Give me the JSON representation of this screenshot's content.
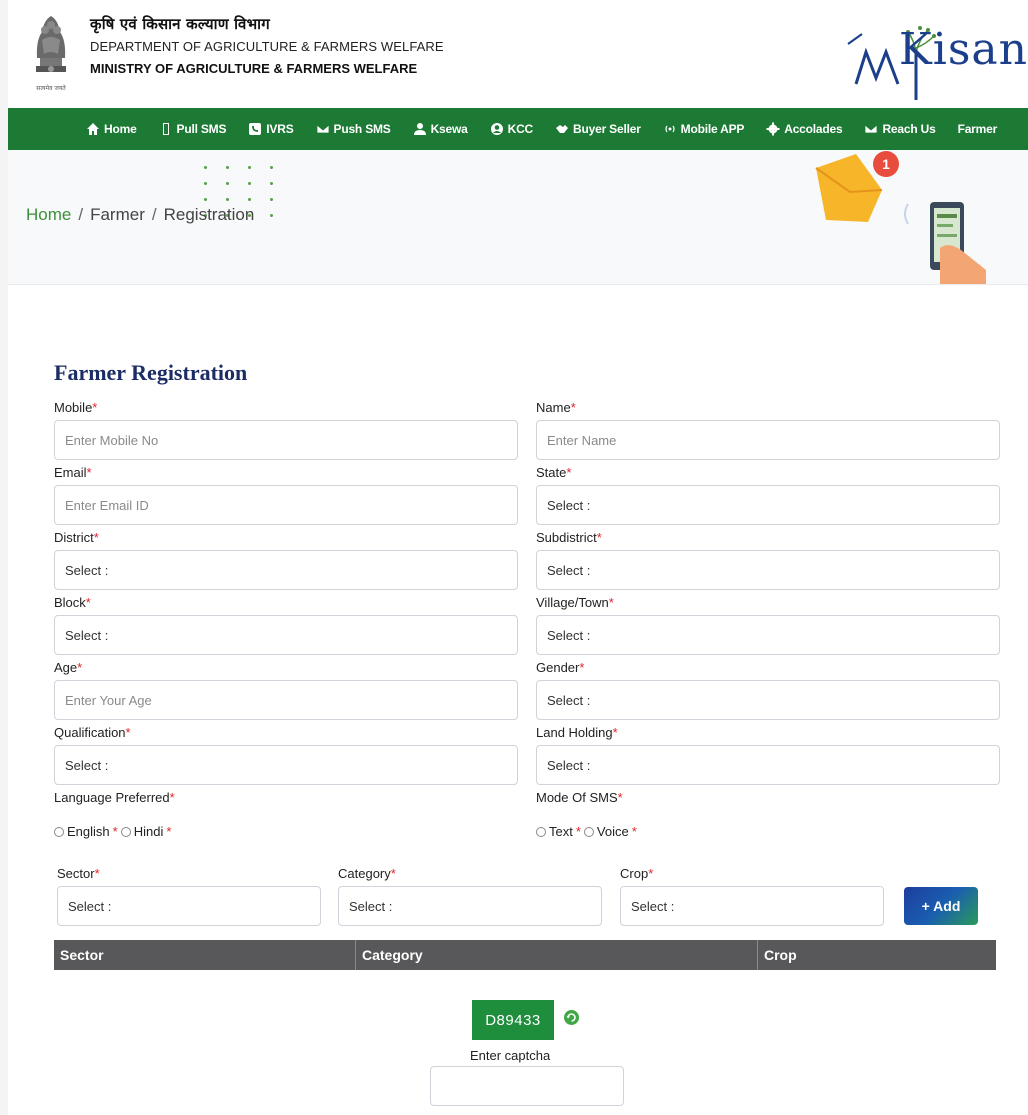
{
  "header": {
    "dept_hindi": "कृषि एवं किसान कल्याण विभाग",
    "dept_english": "DEPARTMENT OF AGRICULTURE & FARMERS WELFARE",
    "ministry": "MINISTRY OF AGRICULTURE & FARMERS WELFARE",
    "emblem_motto": "सत्यमेव जयते",
    "logo_text": "Kisan"
  },
  "nav": {
    "items": [
      {
        "label": "Home",
        "icon": "home-icon"
      },
      {
        "label": "Pull SMS",
        "icon": "phone-outline-icon"
      },
      {
        "label": "IVRS",
        "icon": "phone-icon"
      },
      {
        "label": "Push SMS",
        "icon": "envelope-icon"
      },
      {
        "label": "Ksewa",
        "icon": "user-icon"
      },
      {
        "label": "KCC",
        "icon": "account-circle-icon"
      },
      {
        "label": "Buyer Seller",
        "icon": "handshake-icon"
      },
      {
        "label": "Mobile APP",
        "icon": "signal-icon"
      },
      {
        "label": "Accolades",
        "icon": "cog-icon"
      },
      {
        "label": "Reach Us",
        "icon": "envelope-icon"
      },
      {
        "label": "Farmer",
        "icon": ""
      }
    ]
  },
  "breadcrumb": {
    "home": "Home",
    "section": "Farmer",
    "current": "Registration",
    "separator": "/"
  },
  "banner": {
    "notification_count": "1"
  },
  "form": {
    "title": "Farmer Registration",
    "required_mark": "*",
    "mobile": {
      "label": "Mobile",
      "placeholder": "Enter Mobile No"
    },
    "name": {
      "label": "Name",
      "placeholder": "Enter Name"
    },
    "email": {
      "label": "Email",
      "placeholder": "Enter Email ID"
    },
    "state": {
      "label": "State",
      "value": "Select :"
    },
    "district": {
      "label": "District",
      "value": "Select :"
    },
    "subdistrict": {
      "label": "Subdistrict",
      "value": "Select :"
    },
    "block": {
      "label": "Block",
      "value": "Select :"
    },
    "village": {
      "label": "Village/Town",
      "value": "Select :"
    },
    "age": {
      "label": "Age",
      "placeholder": "Enter Your Age"
    },
    "gender": {
      "label": "Gender",
      "value": "Select :"
    },
    "qualification": {
      "label": "Qualification",
      "value": "Select :"
    },
    "land_holding": {
      "label": "Land Holding",
      "value": "Select :"
    },
    "language": {
      "label": "Language Preferred",
      "option1": "English",
      "option2": "Hindi"
    },
    "sms_mode": {
      "label": "Mode Of SMS",
      "option1": "Text",
      "option2": "Voice"
    },
    "sector": {
      "label": "Sector",
      "value": "Select :"
    },
    "category": {
      "label": "Category",
      "value": "Select :"
    },
    "crop": {
      "label": "Crop",
      "value": "Select :"
    },
    "add_button": "+ Add",
    "table_headers": [
      "Sector",
      "Category",
      "Crop"
    ],
    "captcha_code": "D89433",
    "captcha_label": "Enter captcha"
  },
  "colors": {
    "nav_green": "#1d7a35",
    "title_navy": "#1c2d66",
    "required_red": "#e0222a",
    "table_header": "#58585a",
    "captcha_green": "#1e8d3c"
  }
}
